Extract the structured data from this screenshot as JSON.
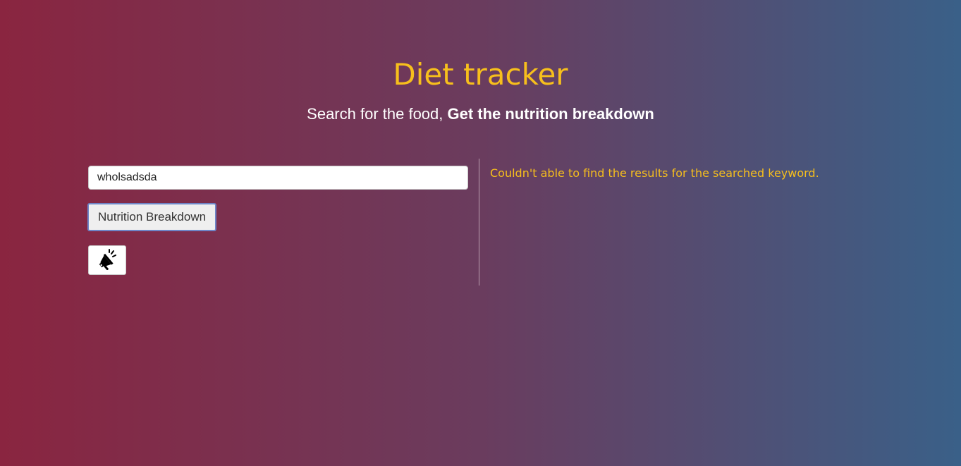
{
  "header": {
    "title": "Diet tracker",
    "subtitle_prefix": "Search for the food, ",
    "subtitle_emphasis": "Get the nutrition breakdown"
  },
  "search": {
    "value": "wholsadsda"
  },
  "actions": {
    "nutrition_button_label": "Nutrition Breakdown",
    "announce_icon": "megaphone-icon"
  },
  "results": {
    "message": "Couldn't able to find the results for the searched keyword."
  },
  "colors": {
    "accent": "#f7bf1c",
    "gradient_left": "#8a2540",
    "gradient_right": "#3a6088"
  }
}
